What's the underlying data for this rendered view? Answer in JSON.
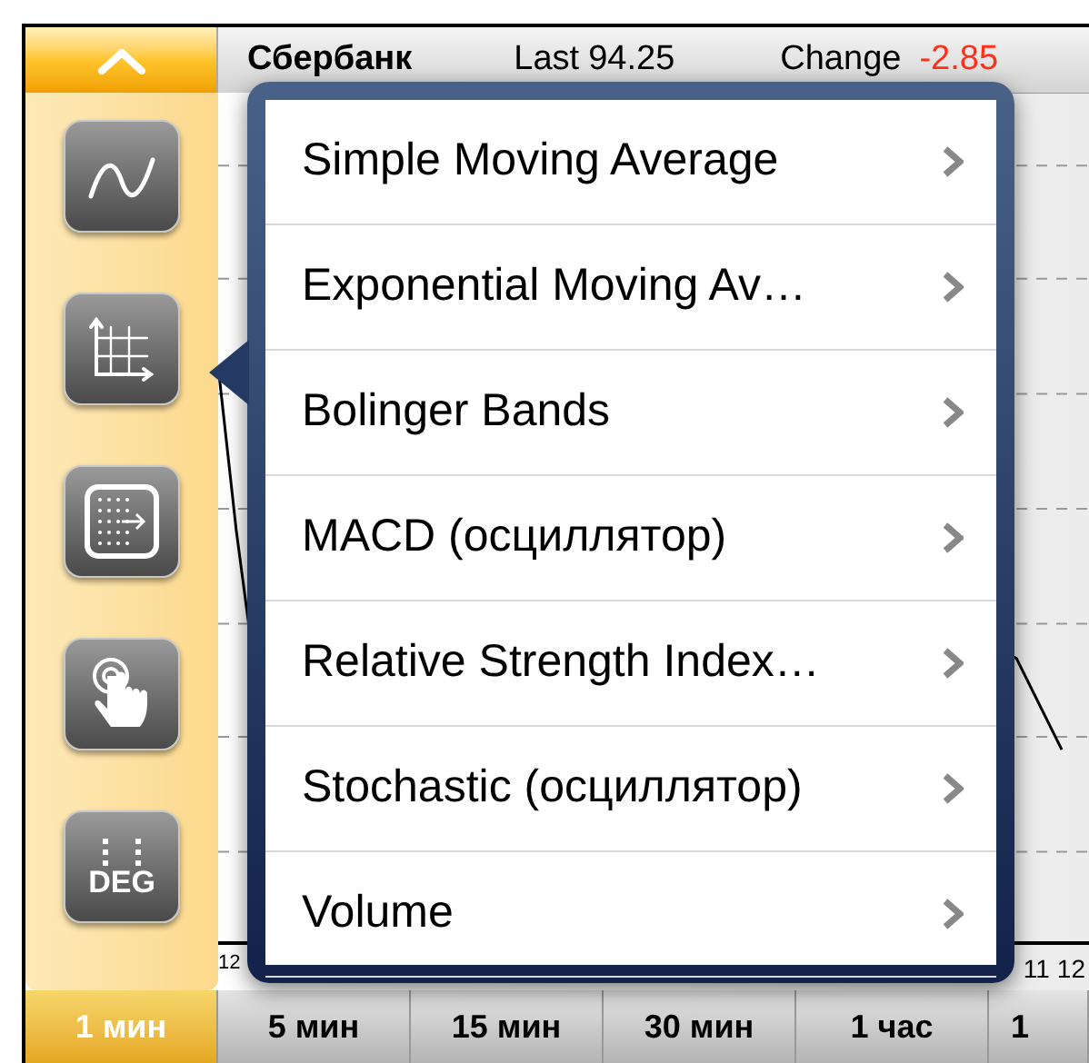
{
  "header": {
    "ticker": "Сбербанк",
    "last_label": "Last",
    "last_value": "94.25",
    "change_label": "Change",
    "change_value": "-2.85"
  },
  "tools": [
    {
      "kind": "wave"
    },
    {
      "kind": "axes"
    },
    {
      "kind": "dots"
    },
    {
      "kind": "tap"
    },
    {
      "kind": "deg",
      "label": "DEG"
    }
  ],
  "chart": {
    "left_axis_label": "12",
    "right_axis_labels": [
      "11",
      "12"
    ]
  },
  "menu": {
    "items": [
      {
        "label": "Simple Moving Average"
      },
      {
        "label": "Exponential Moving Av…"
      },
      {
        "label": "Bolinger Bands"
      },
      {
        "label": "MACD (осциллятор)"
      },
      {
        "label": "Relative Strength Index…"
      },
      {
        "label": "Stochastic (осциллятор)"
      },
      {
        "label": "Volume"
      }
    ]
  },
  "timeframes": [
    {
      "label": "1 мин",
      "selected": true
    },
    {
      "label": "5 мин",
      "selected": false
    },
    {
      "label": "15 мин",
      "selected": false
    },
    {
      "label": "30 мин",
      "selected": false
    },
    {
      "label": "1 час",
      "selected": false
    },
    {
      "label": "1",
      "selected": false
    }
  ]
}
